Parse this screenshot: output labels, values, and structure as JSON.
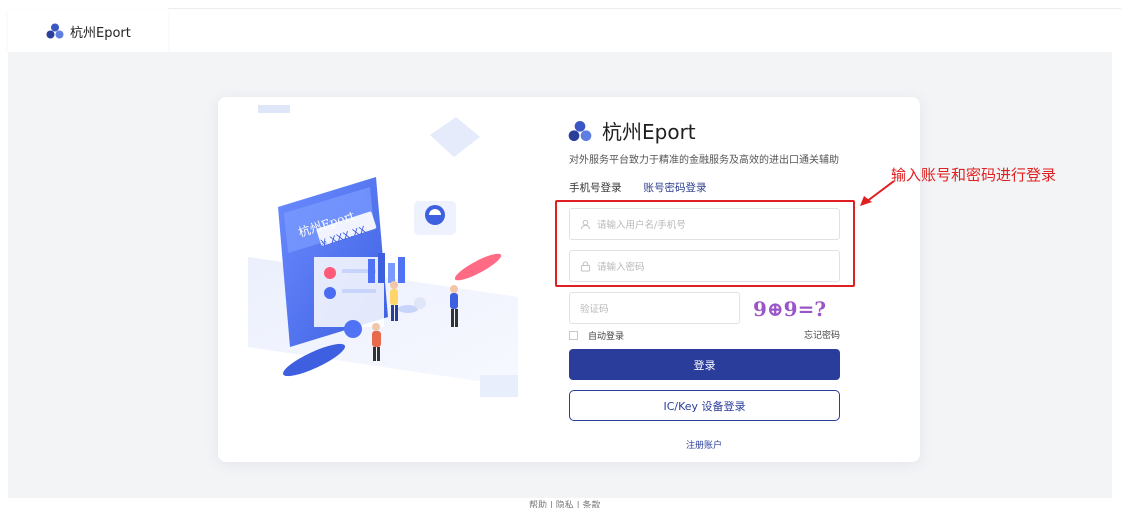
{
  "header": {
    "tab_title": "杭州Eport"
  },
  "login": {
    "brand_title": "杭州Eport",
    "slogan": "对外服务平台致力于精准的金融服务及高效的进出口通关辅助",
    "tabs": [
      "手机号登录",
      "账号密码登录"
    ],
    "active_tab": 1,
    "username_placeholder": "请输入用户名/手机号",
    "password_placeholder": "请输入密码",
    "captcha_placeholder": "验证码",
    "captcha_text": "9⊕9=?",
    "remember_label": "自动登录",
    "forgot_label": "忘记密码",
    "login_button": "登录",
    "ic_button": "IC/Key 设备登录",
    "register_link": "注册账户"
  },
  "illustration": {
    "card_brand": "杭州Eport",
    "card_amount": "¥  XXX.XX"
  },
  "annotation": {
    "text": "输入账号和密码进行登录",
    "color": "#e02020"
  },
  "footer": {
    "text": "帮助  |  隐私  |  条款"
  },
  "colors": {
    "primary": "#2b3d9a",
    "background": "#f3f4f6"
  }
}
